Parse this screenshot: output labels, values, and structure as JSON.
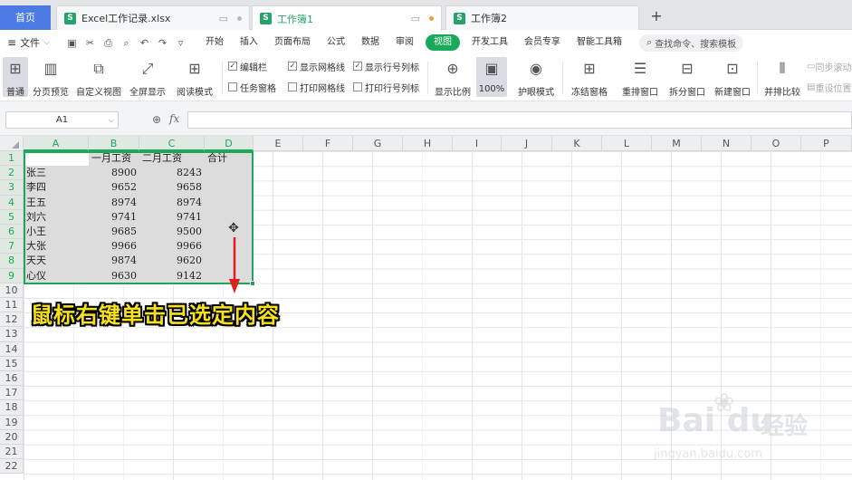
{
  "tabs": {
    "home": "首页",
    "files": [
      {
        "icon": "S",
        "name": "Excel工作记录.xlsx",
        "state": "inactive"
      },
      {
        "icon": "S",
        "name": "工作簿1",
        "state": "active"
      },
      {
        "icon": "S",
        "name": "工作簿2",
        "state": "inactive"
      }
    ],
    "add": "+"
  },
  "menubar": {
    "file": "文件",
    "items": [
      "开始",
      "插入",
      "页面布局",
      "公式",
      "数据",
      "审阅",
      "视图",
      "开发工具",
      "会员专享",
      "智能工具箱"
    ],
    "active": "视图",
    "search": "查找命令、搜索模板"
  },
  "ribbon": {
    "buttons": [
      {
        "label": "普通",
        "icon": "grid-icon",
        "selected": true
      },
      {
        "label": "分页预览",
        "icon": "page-break-icon"
      },
      {
        "label": "自定义视图",
        "icon": "custom-view-icon"
      },
      {
        "label": "全屏显示",
        "icon": "fullscreen-icon"
      },
      {
        "label": "阅读模式",
        "icon": "reading-mode-icon"
      }
    ],
    "checks1": [
      {
        "label": "编辑栏",
        "checked": true
      },
      {
        "label": "任务窗格",
        "checked": false
      }
    ],
    "checks2": [
      {
        "label": "显示网格线",
        "checked": true
      },
      {
        "label": "打印网格线",
        "checked": false
      }
    ],
    "checks3": [
      {
        "label": "显示行号列标",
        "checked": true
      },
      {
        "label": "打印行号列标",
        "checked": false
      }
    ],
    "buttons2": [
      {
        "label": "显示比例",
        "icon": "zoom-icon"
      },
      {
        "label": "100%",
        "icon": "zoom-100-icon",
        "selected": true
      },
      {
        "label": "护眼模式",
        "icon": "eye-icon"
      },
      {
        "label": "冻结窗格",
        "icon": "freeze-icon"
      },
      {
        "label": "重排窗口",
        "icon": "arrange-icon"
      },
      {
        "label": "拆分窗口",
        "icon": "split-icon"
      },
      {
        "label": "新建窗口",
        "icon": "new-window-icon"
      },
      {
        "label": "并排比较",
        "icon": "compare-icon"
      }
    ],
    "side_labels": [
      "同步滚动",
      "重设位置"
    ]
  },
  "formula": {
    "name_box": "A1",
    "fx": "fx",
    "value": ""
  },
  "grid": {
    "columns": [
      "A",
      "B",
      "C",
      "D",
      "E",
      "F",
      "G",
      "H",
      "I",
      "J",
      "K",
      "L",
      "M",
      "N",
      "O",
      "P"
    ],
    "rows": [
      "1",
      "2",
      "3",
      "4",
      "5",
      "6",
      "7",
      "8",
      "9",
      "10",
      "11",
      "12",
      "13",
      "14",
      "15",
      "16",
      "17",
      "18",
      "19",
      "20",
      "21",
      "22"
    ],
    "header_row": [
      "",
      "一月工资",
      "二月工资",
      "合计"
    ],
    "data": [
      [
        "张三",
        8900,
        8243
      ],
      [
        "李四",
        9652,
        9658
      ],
      [
        "王五",
        8974,
        8974
      ],
      [
        "刘六",
        9741,
        9741
      ],
      [
        "小王",
        9685,
        9500
      ],
      [
        "大张",
        9966,
        9966
      ],
      [
        "天天",
        9874,
        9620
      ],
      [
        "心仪",
        9630,
        9142
      ]
    ]
  },
  "annotation": {
    "caption": "鼠标右键单击已选定内容",
    "cursor": "✥"
  },
  "watermark": {
    "logo": "Bai du",
    "jingyan": "经验",
    "url": "jingyan.baidu.com"
  }
}
